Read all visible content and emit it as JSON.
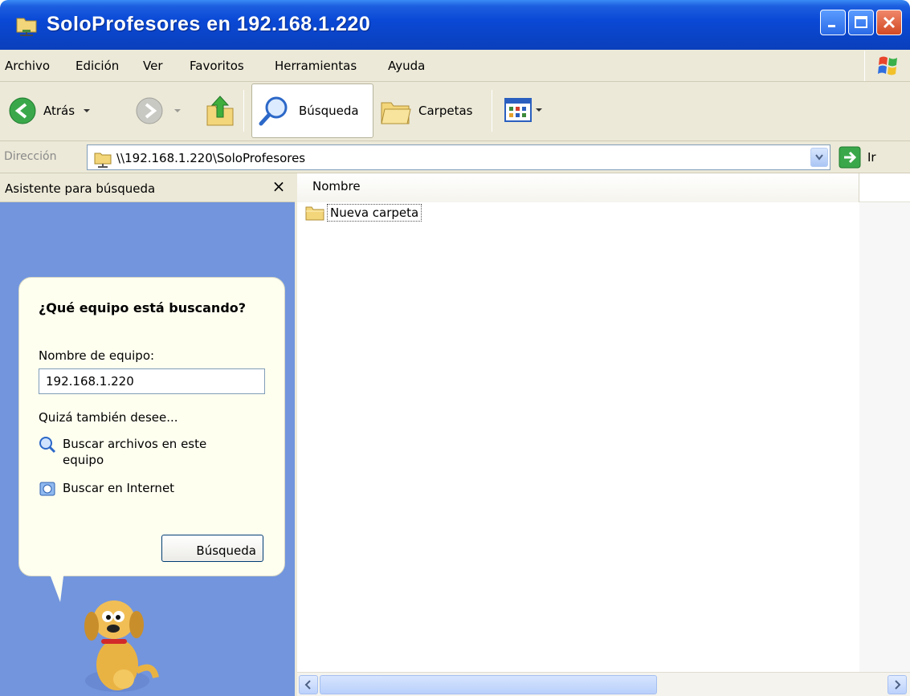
{
  "window": {
    "title": "SoloProfesores en 192.168.1.220"
  },
  "menu": [
    "Archivo",
    "Edición",
    "Ver",
    "Favoritos",
    "Herramientas",
    "Ayuda"
  ],
  "toolbar": {
    "back_label": "Atrás",
    "search_label": "Búsqueda",
    "folders_label": "Carpetas"
  },
  "address": {
    "label": "Dirección",
    "value": "\\\\192.168.1.220\\SoloProfesores",
    "go_label": "Ir"
  },
  "search_pane": {
    "title": "Asistente para búsqueda",
    "close_glyph": "×",
    "heading": "¿Qué equipo está buscando?",
    "computer_name_label": "Nombre de equipo:",
    "computer_name_value": "192.168.1.220",
    "also_label": "Quizá también desee...",
    "links": [
      {
        "label": "Buscar archivos en este equipo",
        "icon": "search-files-icon"
      },
      {
        "label": "Buscar en Internet",
        "icon": "internet-search-icon"
      }
    ],
    "search_button": "Búsqueda"
  },
  "file_list": {
    "column_name": "Nombre",
    "items": [
      {
        "name": "Nueva carpeta",
        "icon": "folder-icon"
      }
    ]
  },
  "colors": {
    "titlebar": "#0a49d6",
    "pane_background": "#7295dd",
    "chrome": "#ece9d8"
  }
}
